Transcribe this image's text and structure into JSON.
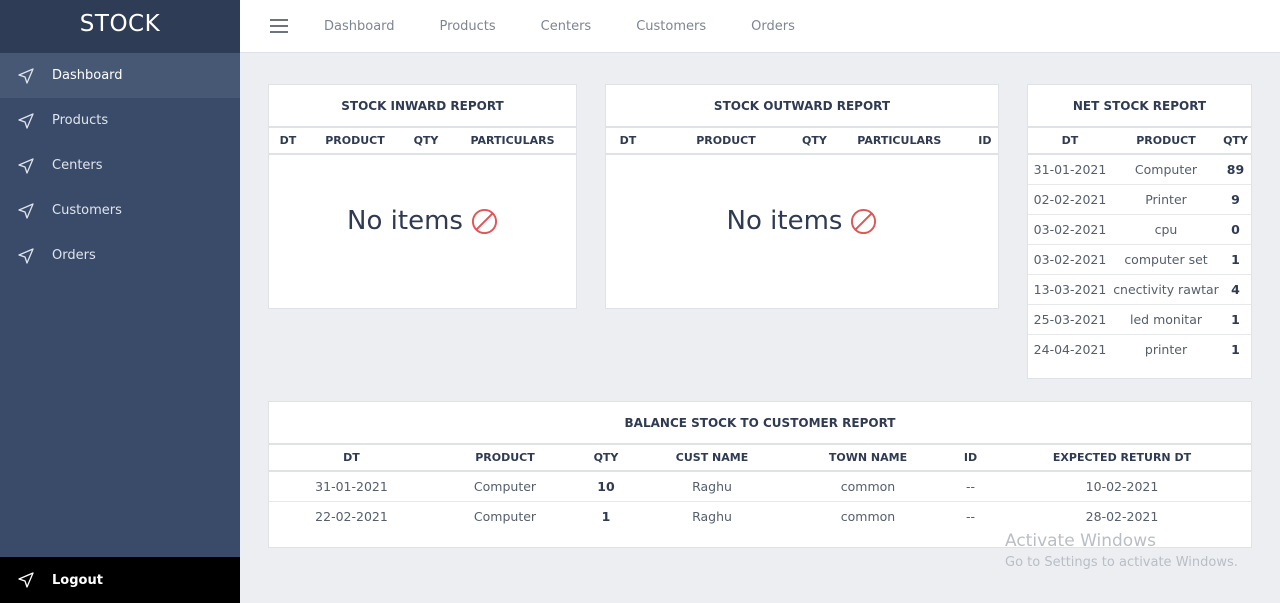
{
  "app": {
    "title": "STOCK"
  },
  "sidebar": {
    "items": [
      {
        "label": "Dashboard",
        "icon": "send-icon"
      },
      {
        "label": "Products",
        "icon": "send-icon"
      },
      {
        "label": "Centers",
        "icon": "send-icon"
      },
      {
        "label": "Customers",
        "icon": "send-icon"
      },
      {
        "label": "Orders",
        "icon": "send-icon"
      }
    ],
    "logout_label": "Logout"
  },
  "topnav": {
    "links": [
      "Dashboard",
      "Products",
      "Centers",
      "Customers",
      "Orders"
    ]
  },
  "inward": {
    "title": "STOCK INWARD REPORT",
    "columns": [
      "DT",
      "PRODUCT",
      "QTY",
      "PARTICULARS"
    ],
    "empty_text": "No items"
  },
  "outward": {
    "title": "STOCK OUTWARD REPORT",
    "columns": [
      "DT",
      "PRODUCT",
      "QTY",
      "PARTICULARS",
      "ID"
    ],
    "empty_text": "No items"
  },
  "net": {
    "title": "NET STOCK REPORT",
    "columns": [
      "DT",
      "PRODUCT",
      "QTY"
    ],
    "rows": [
      [
        "31-01-2021",
        "Computer",
        "89"
      ],
      [
        "02-02-2021",
        "Printer",
        "9"
      ],
      [
        "03-02-2021",
        "cpu",
        "0"
      ],
      [
        "03-02-2021",
        "computer set",
        "1"
      ],
      [
        "13-03-2021",
        "cnectivity rawtar",
        "4"
      ],
      [
        "25-03-2021",
        "led monitar",
        "1"
      ],
      [
        "24-04-2021",
        "printer",
        "1"
      ]
    ]
  },
  "balance": {
    "title": "BALANCE STOCK TO CUSTOMER REPORT",
    "columns": [
      "DT",
      "PRODUCT",
      "QTY",
      "CUST NAME",
      "TOWN NAME",
      "ID",
      "EXPECTED RETURN DT"
    ],
    "rows": [
      [
        "31-01-2021",
        "Computer",
        "10",
        "Raghu",
        "common",
        "--",
        "10-02-2021"
      ],
      [
        "22-02-2021",
        "Computer",
        "1",
        "Raghu",
        "common",
        "--",
        "28-02-2021"
      ]
    ]
  },
  "watermark": {
    "line1": "Activate Windows",
    "line2": "Go to Settings to activate Windows."
  },
  "colors": {
    "sidebar": "#3a4b6a",
    "brand_bar": "#2f3c56",
    "active_item": "#475874",
    "no_items_icon": "#e05555"
  }
}
